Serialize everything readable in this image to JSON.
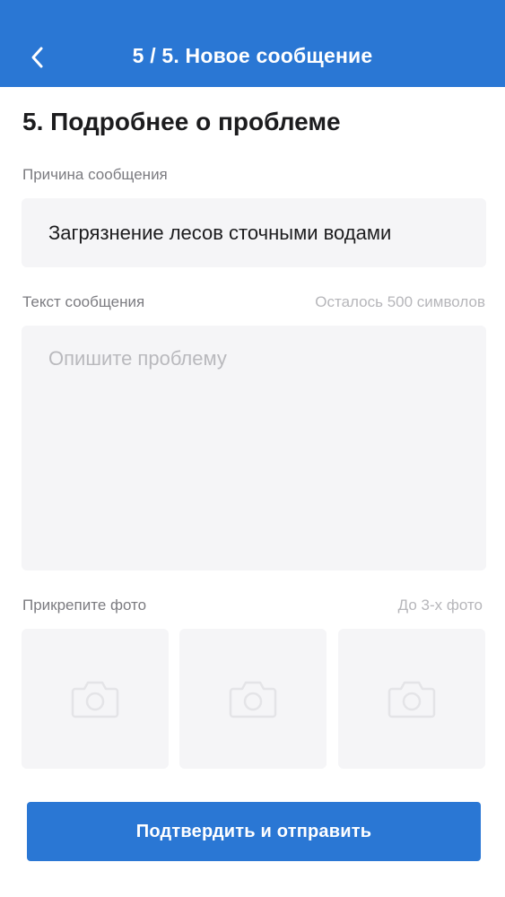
{
  "header": {
    "title": "5 / 5. Новое сообщение",
    "back_icon": "chevron-left-icon"
  },
  "form": {
    "section_title": "5. Подробнее о проблеме",
    "reason": {
      "label": "Причина сообщения",
      "value": "Загрязнение лесов сточными водами"
    },
    "message": {
      "label": "Текст сообщения",
      "counter": "Осталось 500 символов",
      "placeholder": "Опишите проблему",
      "value": ""
    },
    "photos": {
      "label": "Прикрепите фото",
      "limit_hint": "До 3-х фото",
      "slot_icon": "camera-icon"
    },
    "submit_label": "Подтвердить и отправить"
  },
  "colors": {
    "accent": "#2a77d4",
    "field_background": "#f5f5f7",
    "label_text": "#7b7b80",
    "hint_text": "#b6b6ba"
  }
}
